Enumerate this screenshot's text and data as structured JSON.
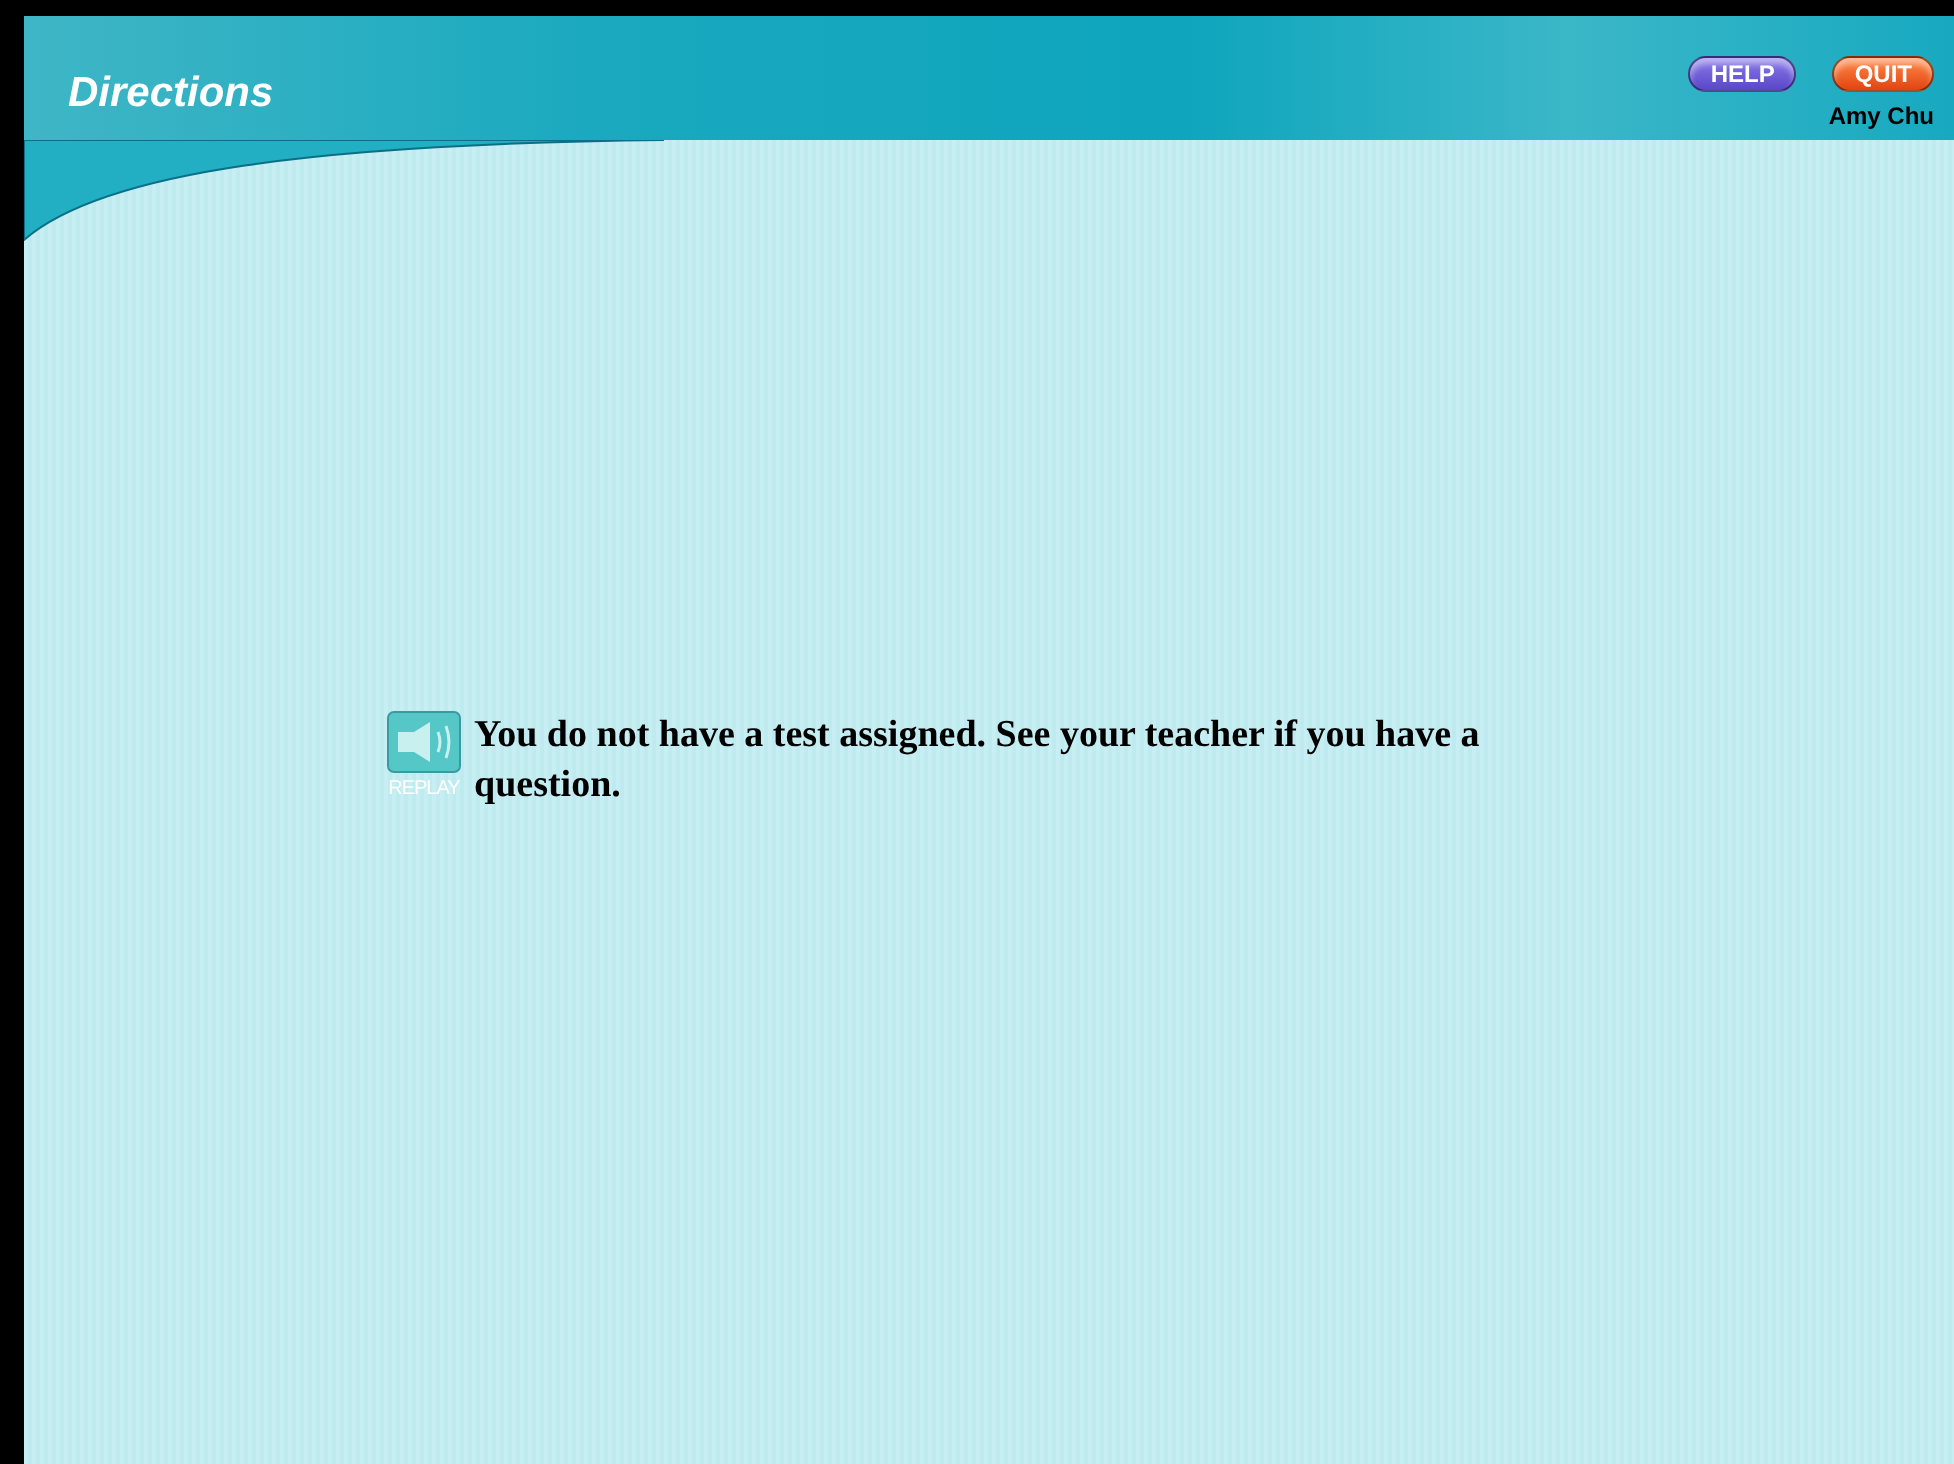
{
  "header": {
    "title": "Directions",
    "buttons": [
      {
        "label": "HELP",
        "kind": "help"
      },
      {
        "label": "QUIT",
        "kind": "quit"
      }
    ],
    "user_name": "Amy Chu"
  },
  "message": {
    "replay_label": "REPLAY",
    "text": "You do not have a test assigned. See your teacher if you have a question."
  }
}
